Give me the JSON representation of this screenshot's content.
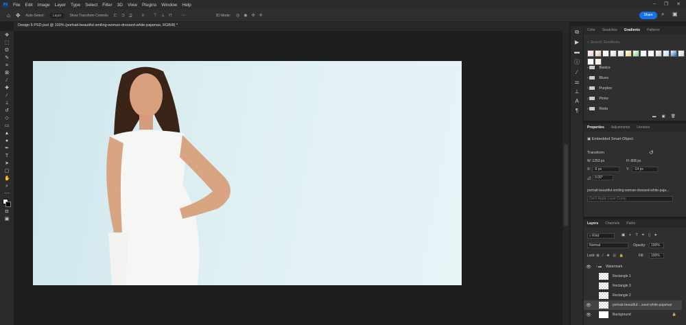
{
  "menu": {
    "items": [
      "File",
      "Edit",
      "Image",
      "Layer",
      "Type",
      "Select",
      "Filter",
      "3D",
      "View",
      "Plugins",
      "Window",
      "Help"
    ]
  },
  "options": {
    "auto_select": "Auto-Select:",
    "layer_select": "Layer",
    "transform_controls": "Show Transform Controls",
    "mode_3d": "3D Mode:",
    "share": "Share"
  },
  "document_tab": {
    "title": "Design 5 PSD.psd @ 100% (portrait-beautiful-smiling-woman-dressed-white-pajamas, RGB/8) *"
  },
  "gradients_panel": {
    "tabs": [
      "Color",
      "Swatches",
      "Gradients",
      "Patterns"
    ],
    "active": "Gradients",
    "search_placeholder": "Search Gradients",
    "folders": [
      "Basics",
      "Blues",
      "Purples",
      "Pinks",
      "Reds"
    ],
    "swatches": [
      "#e8c8b8",
      "#e0b8a8",
      "#f0f0f0",
      "#d8d8d8",
      "#e8d0c0",
      "#f0d070",
      "#80d080",
      "#e0f0f8",
      "#f8f8f8",
      "#c8c8c8",
      "#a8d8f0",
      "#2060c0",
      "#d0d0d0",
      "#f8f8f8",
      "#f8e8c8"
    ]
  },
  "properties_panel": {
    "tabs": [
      "Properties",
      "Adjustments",
      "Libraries"
    ],
    "active": "Properties",
    "object_type": "Embedded Smart Object",
    "transform_label": "Transform",
    "w_label": "W:",
    "w": "1253 px",
    "h_label": "H:",
    "h": "808 px",
    "x_label": "X:",
    "x": "-6 px",
    "y_label": "Y:",
    "y": "-14 px",
    "angle": "0.00°",
    "layer_name": "portrait-beautiful-smiling-woman-dressed-white-paja...",
    "layer_comp": "Don't Apply Layer Comp"
  },
  "layers_panel": {
    "tabs": [
      "Layers",
      "Channels",
      "Paths"
    ],
    "active": "Layers",
    "filter": "Kind",
    "blend_mode": "Normal",
    "opacity_label": "Opacity:",
    "opacity": "100%",
    "lock_label": "Lock:",
    "fill_label": "Fill:",
    "fill": "100%",
    "layers": [
      {
        "name": "Watermark",
        "type": "group",
        "visible": true
      },
      {
        "name": "Rectangle 1",
        "visible": false
      },
      {
        "name": "Rectangle 3",
        "visible": false
      },
      {
        "name": "Rectangle 2",
        "visible": false
      },
      {
        "name": "portrait-beautiful-...ssed-white-pajamas",
        "visible": true,
        "selected": true
      },
      {
        "name": "Background",
        "visible": true,
        "locked": true
      }
    ]
  },
  "colors": {
    "accent": "#1473e6",
    "wall": "#dceef2"
  }
}
